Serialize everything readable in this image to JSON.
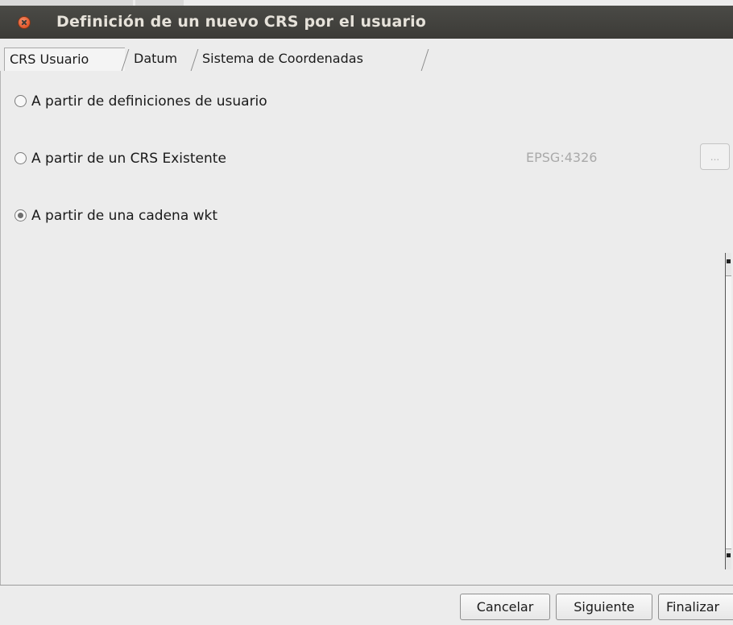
{
  "window": {
    "title": "Definición de un nuevo CRS por el usuario"
  },
  "tabs": [
    {
      "label": "CRS Usuario",
      "selected": true
    },
    {
      "label": "Datum",
      "selected": false
    },
    {
      "label": "Sistema de Coordenadas",
      "selected": false
    }
  ],
  "options": [
    {
      "label": "A partir de definiciones de usuario",
      "checked": false
    },
    {
      "label": "A partir de un CRS Existente",
      "checked": false
    },
    {
      "label": "A partir de una cadena wkt",
      "checked": true
    }
  ],
  "existing_crs": {
    "code": "EPSG:4326",
    "browse_label": "..."
  },
  "buttons": {
    "cancel": "Cancelar",
    "next": "Siguiente",
    "finish": "Finalizar"
  },
  "colors": {
    "titlebar": "#3c3b37",
    "close_button": "#e2562a",
    "panel_background": "#ececec"
  }
}
